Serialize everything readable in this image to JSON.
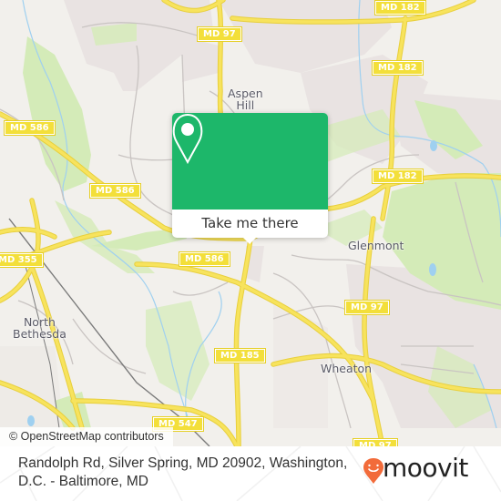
{
  "map": {
    "colors": {
      "background": "#f2f0ec",
      "residential": "#e9e3e2",
      "park": "#d4ebb8",
      "road_major": "#f7e35d",
      "road_minor": "#c9c4c2",
      "water": "#9fd0f0",
      "rail": "#777777",
      "shield_fill": "#f3df3a"
    },
    "route_shields": [
      {
        "label": "MD 182"
      },
      {
        "label": "MD 97"
      },
      {
        "label": "MD 182"
      },
      {
        "label": "MD 586"
      },
      {
        "label": "MD 586"
      },
      {
        "label": "MD 182"
      },
      {
        "label": "MD 355"
      },
      {
        "label": "MD 586"
      },
      {
        "label": "MD 97"
      },
      {
        "label": "MD 185"
      },
      {
        "label": "MD 547"
      },
      {
        "label": "MD 97"
      }
    ],
    "places": [
      {
        "name": "Aspen Hill",
        "line1": "Aspen",
        "line2": "Hill"
      },
      {
        "name": "Glenmont",
        "line1": "Glenmont"
      },
      {
        "name": "North Bethesda",
        "line1": "North",
        "line2": "Bethesda"
      },
      {
        "name": "Wheaton",
        "line1": "Wheaton"
      }
    ],
    "attribution": "© OpenStreetMap contributors"
  },
  "popup": {
    "icon": "map-pin-icon",
    "accent_color": "#1db76a",
    "button_label": "Take me there"
  },
  "footer": {
    "address": "Randolph Rd, Silver Spring, MD 20902, Washington, D.C. - Baltimore, MD",
    "logo": {
      "text": "moovit",
      "icon": "moovit-pin-smile-icon",
      "accent_color": "#f26b3a"
    }
  }
}
